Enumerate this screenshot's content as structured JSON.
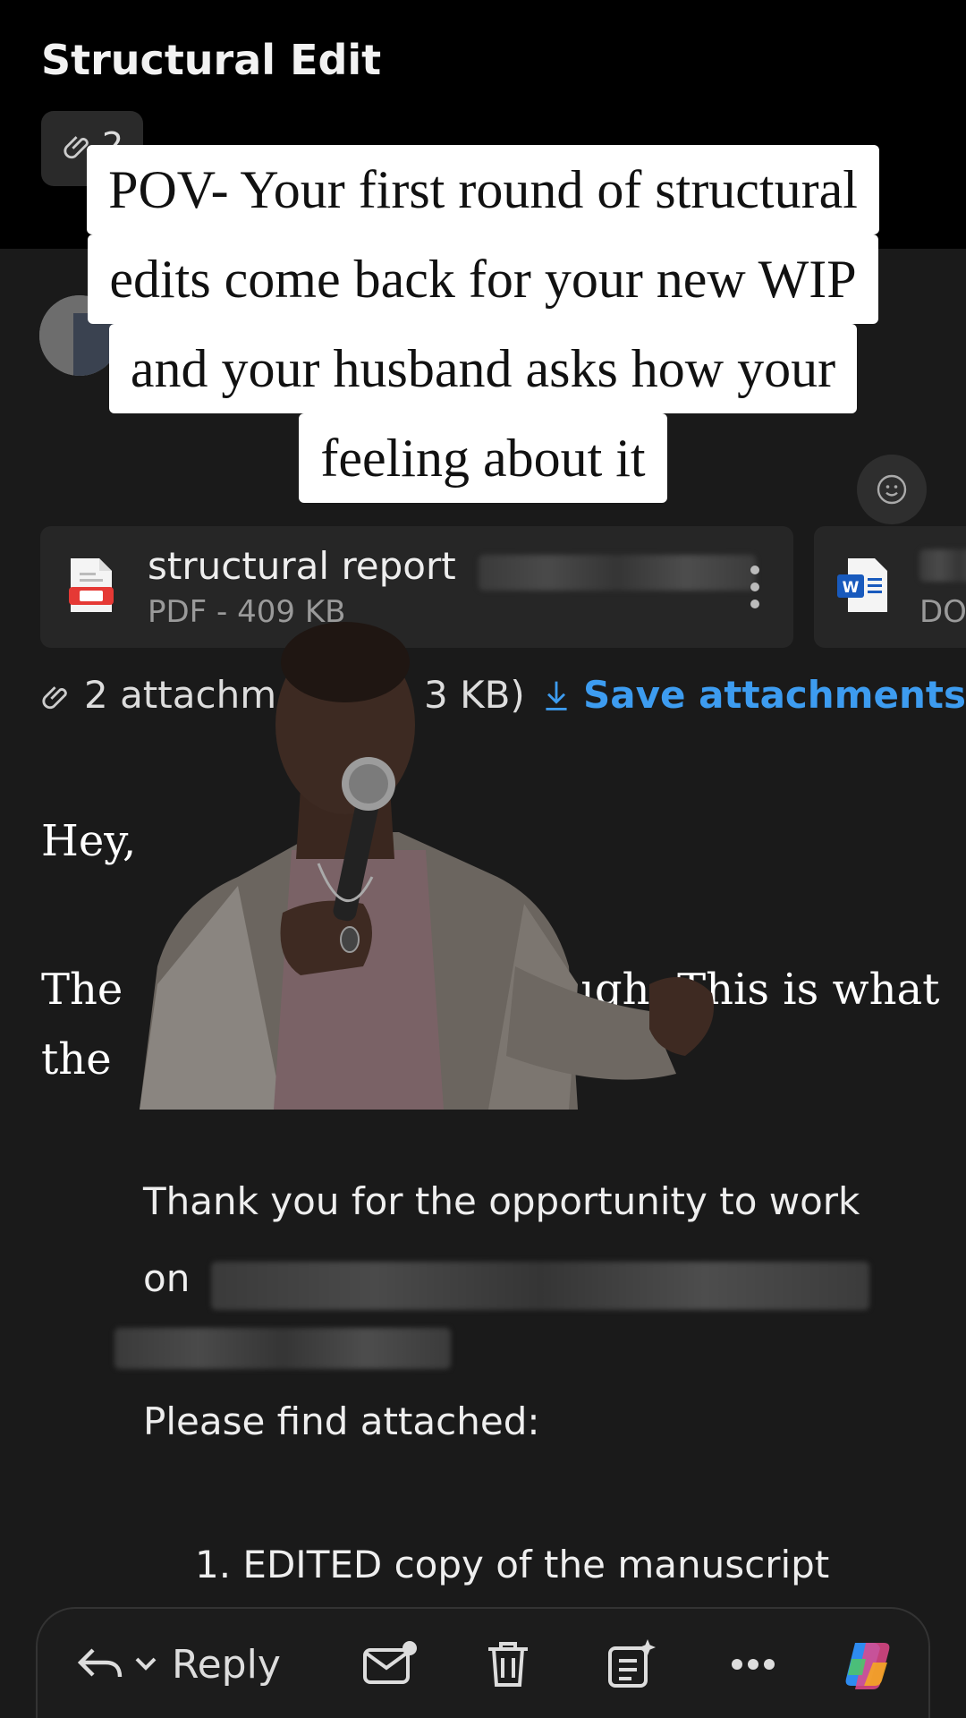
{
  "header": {
    "subject": "Structural Edit",
    "attachment_count": "2"
  },
  "caption": {
    "lines": [
      "POV- Your first round of structural",
      "edits come back for your new WIP",
      "and your husband asks how your",
      "feeling about it"
    ]
  },
  "attachments": [
    {
      "name": "structural report",
      "meta": "PDF - 409 KB",
      "icon": "pdf-file-icon"
    },
    {
      "name": "",
      "meta": "DO",
      "icon": "word-doc-icon"
    }
  ],
  "attachment_bar": {
    "summary": "2 attachm",
    "size_tail": "3 KB)",
    "save_label": "Save attachments"
  },
  "body": {
    "greeting": "Hey,",
    "line1_start": "The",
    "line1_end": "ugh. This is what",
    "line2_start": "the",
    "quote_line1": "Thank you for the opportunity to work",
    "quote_line2_start": "on",
    "please_find": "Please find attached:",
    "list_item_1": "1. EDITED copy of the manuscript"
  },
  "bottom_bar": {
    "reply_label": "Reply"
  },
  "colors": {
    "accent": "#3d9cf0",
    "background": "#1a1a1a",
    "topbar": "#000000"
  }
}
